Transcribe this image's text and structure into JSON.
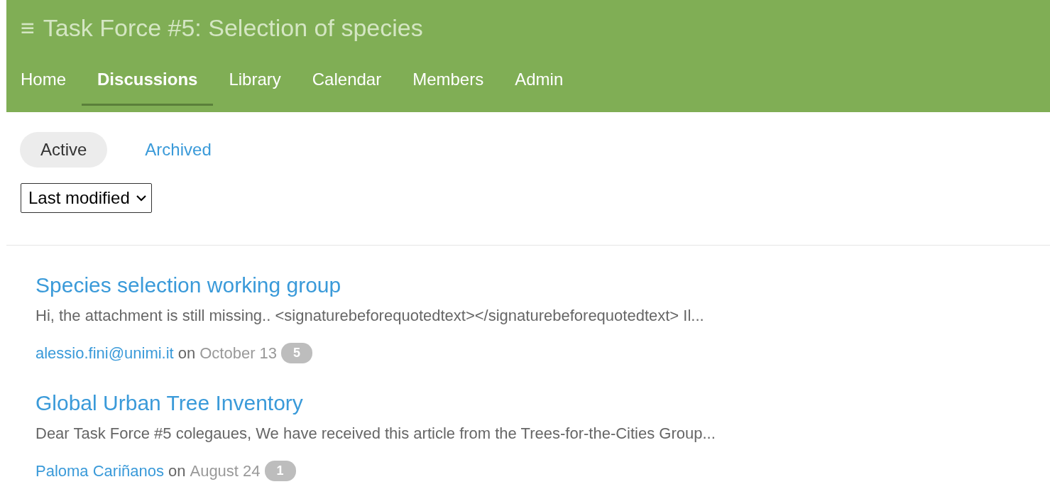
{
  "header": {
    "menu_icon": "≡",
    "title": "Task Force #5: Selection of species"
  },
  "nav": [
    {
      "label": "Home",
      "selected": false
    },
    {
      "label": "Discussions",
      "selected": true
    },
    {
      "label": "Library",
      "selected": false
    },
    {
      "label": "Calendar",
      "selected": false
    },
    {
      "label": "Members",
      "selected": false
    },
    {
      "label": "Admin",
      "selected": false
    }
  ],
  "filters": [
    {
      "label": "Active",
      "selected": true
    },
    {
      "label": "Archived",
      "selected": false
    }
  ],
  "sort": {
    "value": "Last modified"
  },
  "threads": [
    {
      "title": "Species selection working group",
      "snippet": "Hi, the attachment is still missing.. <signaturebeforequotedtext></signaturebeforequotedtext> Il...",
      "author": "alessio.fini@unimi.it",
      "on": "on",
      "date": "October 13",
      "count": "5"
    },
    {
      "title": "Global Urban Tree Inventory",
      "snippet": "Dear Task Force #5 colegaues, We have received this article from the Trees-for-the-Cities Group...",
      "author": "Paloma Cariñanos",
      "on": "on",
      "date": "August 24",
      "count": "1"
    }
  ]
}
